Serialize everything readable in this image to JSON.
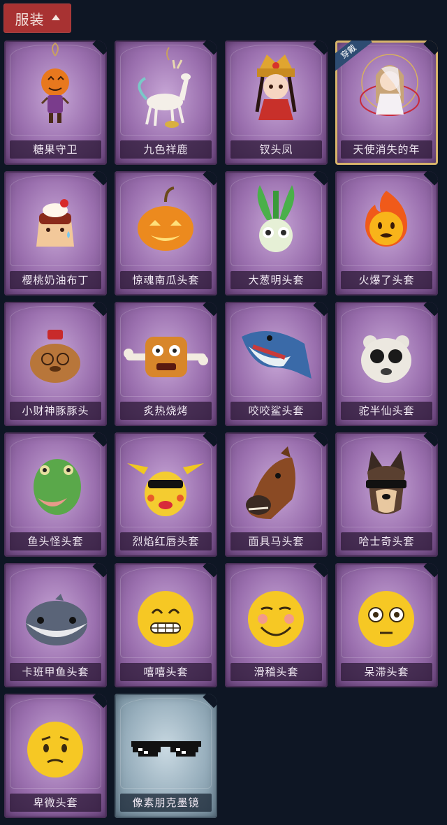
{
  "header": {
    "title": "服装"
  },
  "badge": "穿戴",
  "items": [
    {
      "name": "糖果守卫",
      "icon": "pumpkin-guard-icon",
      "style": "purple"
    },
    {
      "name": "九色祥鹿",
      "icon": "deer-icon",
      "style": "purple"
    },
    {
      "name": "钗头凤",
      "icon": "phoenix-crown-doll-icon",
      "style": "purple"
    },
    {
      "name": "天使消失的年",
      "icon": "angel-doll-icon",
      "style": "purple",
      "worn": true
    },
    {
      "name": "樱桃奶油布丁",
      "icon": "pudding-icon",
      "style": "purple"
    },
    {
      "name": "惊魂南瓜头套",
      "icon": "pumpkin-head-icon",
      "style": "purple"
    },
    {
      "name": "大葱明头套",
      "icon": "scallion-head-icon",
      "style": "purple"
    },
    {
      "name": "火爆了头套",
      "icon": "fire-head-icon",
      "style": "purple"
    },
    {
      "name": "小财神豚豚头",
      "icon": "capybara-head-icon",
      "style": "purple"
    },
    {
      "name": "炙热烧烤",
      "icon": "bbq-head-icon",
      "style": "purple"
    },
    {
      "name": "咬咬鲨头套",
      "icon": "shark-head-icon",
      "style": "purple"
    },
    {
      "name": "驼半仙头套",
      "icon": "bear-sunglasses-head-icon",
      "style": "purple"
    },
    {
      "name": "鱼头怪头套",
      "icon": "fish-head-icon",
      "style": "purple"
    },
    {
      "name": "烈焰红唇头套",
      "icon": "pikachu-sunglasses-head-icon",
      "style": "purple"
    },
    {
      "name": "面具马头套",
      "icon": "horse-mask-icon",
      "style": "purple"
    },
    {
      "name": "哈士奇头套",
      "icon": "husky-sunglasses-head-icon",
      "style": "purple"
    },
    {
      "name": "卡班甲鱼头套",
      "icon": "fish-round-head-icon",
      "style": "purple"
    },
    {
      "name": "嘻嘻头套",
      "icon": "grin-emoji-icon",
      "style": "purple"
    },
    {
      "name": "滑稽头套",
      "icon": "funny-emoji-icon",
      "style": "purple"
    },
    {
      "name": "呆滞头套",
      "icon": "stunned-emoji-icon",
      "style": "purple"
    },
    {
      "name": "卑微头套",
      "icon": "humble-emoji-icon",
      "style": "purple"
    },
    {
      "name": "像素朋克墨镜",
      "icon": "pixel-sunglasses-icon",
      "style": "blue"
    }
  ]
}
